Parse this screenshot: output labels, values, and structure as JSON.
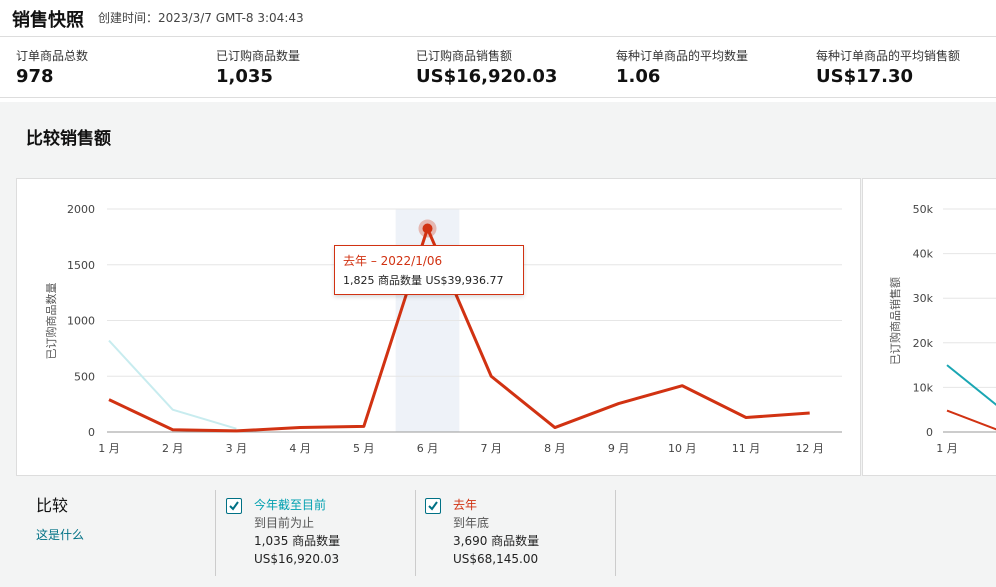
{
  "header": {
    "title": "销售快照",
    "created": "创建时间：2023/3/7 GMT-8 3:04:43"
  },
  "metrics": [
    {
      "label": "订单商品总数",
      "value": "978"
    },
    {
      "label": "已订购商品数量",
      "value": "1,035"
    },
    {
      "label": "已订购商品销售额",
      "value": "US$16,920.03"
    },
    {
      "label": "每种订单商品的平均数量",
      "value": "1.06"
    },
    {
      "label": "每种订单商品的平均销售额",
      "value": "US$17.30"
    }
  ],
  "section": {
    "title": "比较销售额"
  },
  "colors": {
    "current_year": "#c8ecef",
    "last_year": "#d13212",
    "link": "#007185",
    "highlight_band": "#eef2f8"
  },
  "tooltip": {
    "title": "去年 – 2022/1/06",
    "body": "1,825 商品数量 US$39,936.77"
  },
  "chart_data": [
    {
      "type": "line",
      "ylabel": "已订购商品数量",
      "ylim": [
        0,
        2000
      ],
      "yticks": [
        "0",
        "500",
        "1000",
        "1500",
        "2000"
      ],
      "categories": [
        "1 月",
        "2 月",
        "3 月",
        "4 月",
        "5 月",
        "6 月",
        "7 月",
        "8 月",
        "9 月",
        "10 月",
        "11 月",
        "12 月"
      ],
      "highlight_category": "6 月",
      "grid": true,
      "series": [
        {
          "name": "今年截至目前",
          "color": "#c8ecef",
          "values": [
            820,
            200,
            30,
            null,
            null,
            null,
            null,
            null,
            null,
            null,
            null,
            null
          ]
        },
        {
          "name": "去年",
          "color": "#d13212",
          "values": [
            290,
            20,
            10,
            40,
            50,
            1825,
            500,
            40,
            255,
            415,
            130,
            170
          ]
        }
      ]
    },
    {
      "type": "line",
      "ylabel": "已订购商品销售额",
      "ylim": [
        0,
        50000
      ],
      "yticks": [
        "0",
        "10k",
        "20k",
        "30k",
        "40k",
        "50k"
      ],
      "categories": [
        "1 月"
      ],
      "grid": true,
      "series": [
        {
          "color": "#1aa6b3",
          "values": [
            15000
          ]
        },
        {
          "color": "#d13212",
          "values": [
            4800
          ]
        }
      ]
    }
  ],
  "compare": {
    "title": "比较",
    "link": "这是什么"
  },
  "legend": [
    {
      "name": "今年截至目前",
      "sub": "到目前为止",
      "count": "1,035 商品数量",
      "sales": "US$16,920.03"
    },
    {
      "name": "去年",
      "sub": "到年底",
      "count": "3,690 商品数量",
      "sales": "US$68,145.00"
    }
  ]
}
